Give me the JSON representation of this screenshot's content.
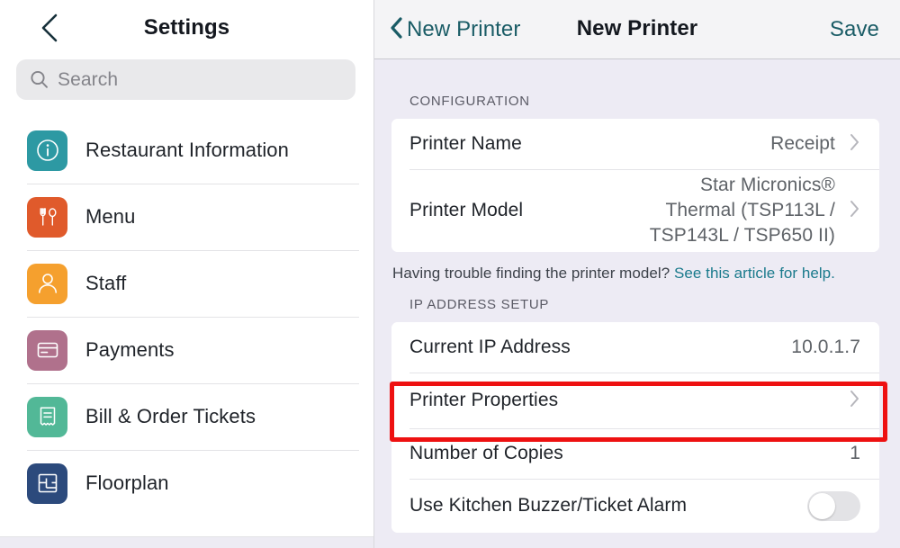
{
  "sidebar": {
    "back_icon": "chevron-left-icon",
    "title": "Settings",
    "search": {
      "icon": "search-icon",
      "placeholder": "Search",
      "value": ""
    },
    "items": [
      {
        "label": "Restaurant Information",
        "icon": "info-circle-icon",
        "color": "#2d99a3"
      },
      {
        "label": "Menu",
        "icon": "fork-spoon-icon",
        "color": "#e05a2b"
      },
      {
        "label": "Staff",
        "icon": "person-icon",
        "color": "#f5a02e"
      },
      {
        "label": "Payments",
        "icon": "credit-card-icon",
        "color": "#b0718c"
      },
      {
        "label": "Bill & Order Tickets",
        "icon": "receipt-icon",
        "color": "#52b897"
      },
      {
        "label": "Floorplan",
        "icon": "floorplan-icon",
        "color": "#2c4a7c"
      }
    ]
  },
  "detail": {
    "back_icon": "chevron-left-icon",
    "back_label": "New Printer",
    "title": "New Printer",
    "save_label": "Save",
    "accent_color": "#1a5c66",
    "sections": [
      {
        "label": "CONFIGURATION",
        "rows": [
          {
            "label": "Printer Name",
            "value": "Receipt",
            "accessory": "chevron-right-icon"
          },
          {
            "label": "Printer Model",
            "value": "Star Micronics®\nThermal (TSP113L /\nTSP143L / TSP650 II)",
            "accessory": "chevron-right-icon"
          }
        ],
        "footer_text": "Having trouble finding the printer model? ",
        "footer_link": "See this article for help."
      },
      {
        "label": "IP ADDRESS SETUP",
        "rows": [
          {
            "label": "Current IP Address",
            "value": "10.0.1.7",
            "accessory": "none"
          },
          {
            "label": "Printer Properties",
            "value": "",
            "accessory": "chevron-right-icon",
            "highlighted": true
          },
          {
            "label": "Number of Copies",
            "value": "1",
            "accessory": "none"
          },
          {
            "label": "Use Kitchen Buzzer/Ticket Alarm",
            "value": "",
            "accessory": "toggle-off"
          }
        ]
      }
    ]
  },
  "highlight": {
    "color": "#ee1111",
    "target": "Printer Properties"
  }
}
